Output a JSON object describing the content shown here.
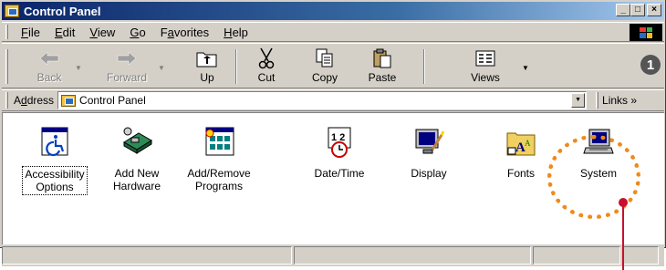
{
  "window": {
    "title": "Control Panel"
  },
  "title_buttons": {
    "minimize": "_",
    "maximize": "□",
    "close": "×"
  },
  "menu": [
    {
      "label": "File",
      "key": "F",
      "rest": "ile"
    },
    {
      "label": "Edit",
      "key": "E",
      "rest": "dit"
    },
    {
      "label": "View",
      "key": "V",
      "rest": "iew"
    },
    {
      "label": "Go",
      "key": "G",
      "rest": "o"
    },
    {
      "label": "Favorites",
      "pre": "F",
      "key": "a",
      "rest": "vorites"
    },
    {
      "label": "Help",
      "key": "H",
      "rest": "elp"
    }
  ],
  "toolbar": {
    "back": "Back",
    "forward": "Forward",
    "up": "Up",
    "cut": "Cut",
    "copy": "Copy",
    "paste": "Paste",
    "views": "Views"
  },
  "callout": "1",
  "address": {
    "label_pre": "A",
    "label_key": "d",
    "label_rest": "dress",
    "value": "Control Panel",
    "links": "Links »"
  },
  "items": [
    {
      "line1": "Accessibility",
      "line2": "Options",
      "icon": "accessibility-icon"
    },
    {
      "line1": "Add New",
      "line2": "Hardware",
      "icon": "add-hardware-icon"
    },
    {
      "line1": "Add/Remove",
      "line2": "Programs",
      "icon": "add-remove-programs-icon"
    },
    {
      "line1": "Date/Time",
      "line2": "",
      "icon": "date-time-icon"
    },
    {
      "line1": "Display",
      "line2": "",
      "icon": "display-icon"
    },
    {
      "line1": "Fonts",
      "line2": "",
      "icon": "fonts-icon"
    },
    {
      "line1": "System",
      "line2": "",
      "icon": "system-icon"
    }
  ],
  "colors": {
    "annotation_ring": "#f08a1a",
    "pointer": "#c8102e",
    "titlebar": "#0a246a"
  }
}
